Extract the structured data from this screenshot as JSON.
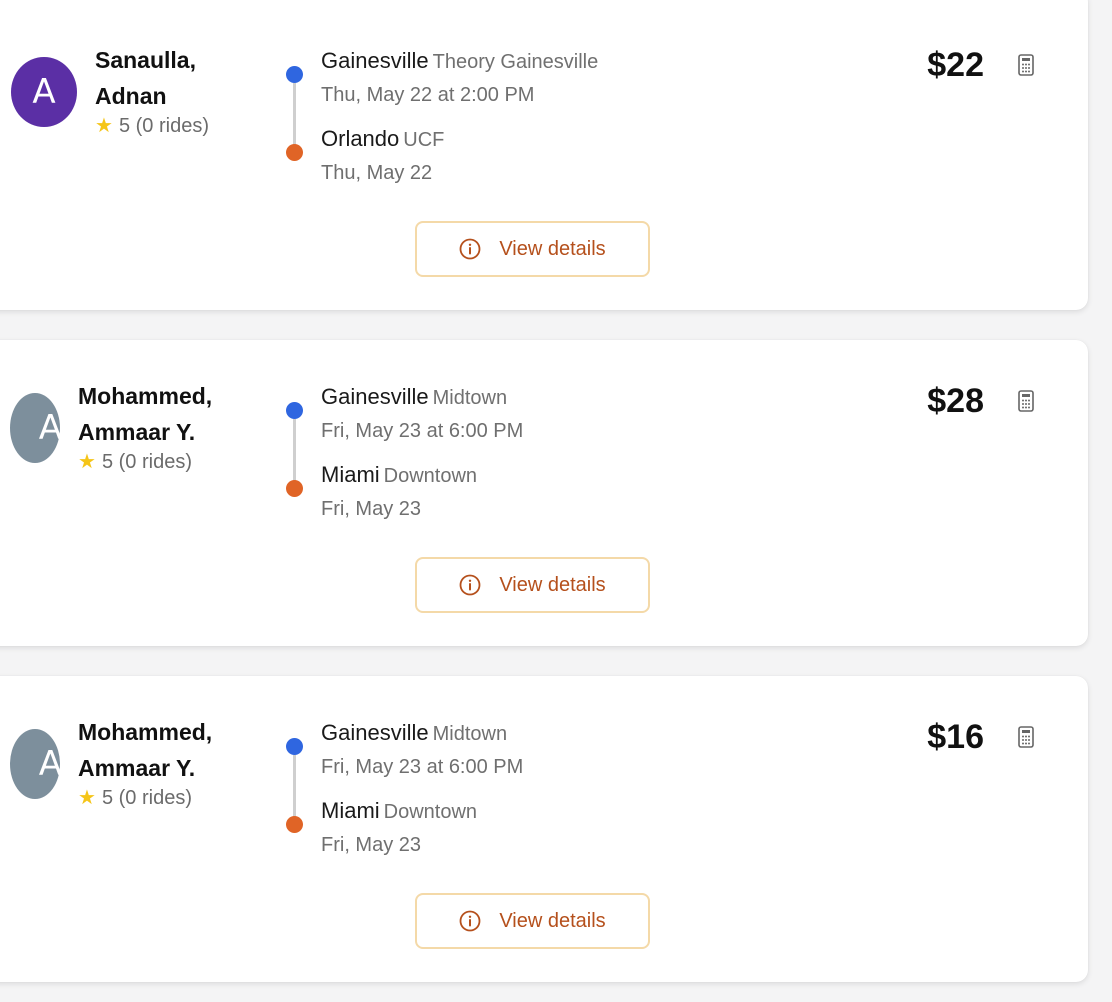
{
  "rides": [
    {
      "avatar_letter": "A",
      "avatar_color": "#5b2fa5",
      "driver_name_line1": "Sanaulla,",
      "driver_name_line2": "Adnan",
      "rating": "5",
      "rides_count": "(0 rides)",
      "origin_city": "Gainesville",
      "origin_area": "Theory Gainesville",
      "origin_time": "Thu, May 22 at 2:00 PM",
      "dest_city": "Orlando",
      "dest_area": "UCF",
      "dest_date": "Thu, May 22",
      "price": "$22",
      "details_label": "View details"
    },
    {
      "avatar_letter": "A",
      "avatar_color": "#7d8f9c",
      "driver_name_line1": "Mohammed,",
      "driver_name_line2": "Ammaar Y.",
      "rating": "5",
      "rides_count": "(0 rides)",
      "origin_city": "Gainesville",
      "origin_area": "Midtown",
      "origin_time": "Fri, May 23 at 6:00 PM",
      "dest_city": "Miami",
      "dest_area": "Downtown",
      "dest_date": "Fri, May 23",
      "price": "$28",
      "details_label": "View details"
    },
    {
      "avatar_letter": "A",
      "avatar_color": "#7d8f9c",
      "driver_name_line1": "Mohammed,",
      "driver_name_line2": "Ammaar Y.",
      "rating": "5",
      "rides_count": "(0 rides)",
      "origin_city": "Gainesville",
      "origin_area": "Midtown",
      "origin_time": "Fri, May 23 at 6:00 PM",
      "dest_city": "Miami",
      "dest_area": "Downtown",
      "dest_date": "Fri, May 23",
      "price": "$16",
      "details_label": "View details"
    }
  ],
  "icons": {
    "star": "star-icon",
    "calculator": "calculator-icon",
    "info": "info-icon"
  },
  "colors": {
    "origin_dot": "#2f66e0",
    "dest_dot": "#e06426",
    "details_text": "#b5501c",
    "details_border": "#f4d9a8",
    "rating_star": "#f5c518"
  }
}
